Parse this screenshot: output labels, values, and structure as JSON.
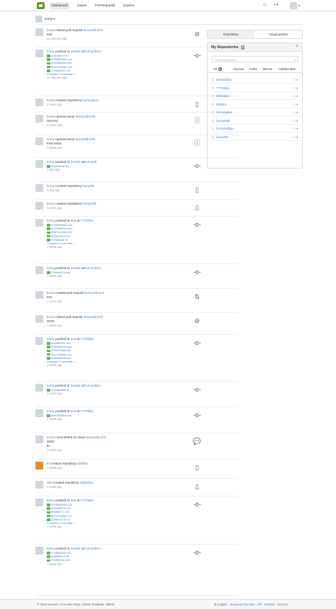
{
  "nav": {
    "dashboard": "Dashboard",
    "issues": "Issues",
    "pull_requests": "Pull Requests",
    "explore": "Explore"
  },
  "context_user": "lunny",
  "feed": [
    {
      "user": "lunny",
      "action": "closed pull request",
      "target": "lunny/ddoc#4",
      "text": "test",
      "time": "11 minutes ago",
      "icon": "pr-closed-icon",
      "glyph": "⊘"
    },
    {
      "user": "lunny",
      "action": "pushed to",
      "branch": "master",
      "at": "at",
      "target": "lunny/ddoc",
      "commits": [
        "c7609fe7f4 rrr",
        "879645ed43 ooo",
        "9c42de64bc eee",
        "8047bc2d6e 222",
        "1336e4624 111"
      ],
      "compare": "Compare 5 commits »",
      "time": "11 minutes ago",
      "icon": "commit-icon",
      "glyph": "-o-"
    },
    {
      "user": "lunny",
      "action": "created repository",
      "target": "lunny/gitea",
      "time": "2 hours ago",
      "icon": "repo-icon",
      "glyph": "▯"
    },
    {
      "user": "lunny",
      "action": "opened issue",
      "target": "lunny/ddoc#6",
      "text": "Second",
      "time": "2 hours ago",
      "icon": "issue-icon",
      "glyph": "ⓘ"
    },
    {
      "user": "lunny",
      "action": "opened issue",
      "target": "lunny/ddoc#5",
      "text": "First issue",
      "time": "2 hours ago",
      "icon": "issue-icon",
      "glyph": "ⓘ"
    },
    {
      "user": "lunny",
      "action": "pushed to",
      "branch": "master",
      "at": "at",
      "target": "lunny/ttt",
      "commits": [
        "2b8fb3ba6 sss"
      ],
      "time": "1 day ago",
      "icon": "commit-icon",
      "glyph": "-o-"
    },
    {
      "user": "lunny",
      "action": "created repository",
      "target": "lunny/ttt",
      "time": "1 day ago",
      "icon": "repo-icon",
      "glyph": "▯"
    },
    {
      "user": "lunny",
      "action": "created repository",
      "target": "lunny/sdk",
      "time": "1 week ago",
      "icon": "repo-icon",
      "glyph": "▯"
    },
    {
      "user": "lunny",
      "action": "pushed to",
      "branch": "test",
      "at": "at",
      "target": "777/ddoc",
      "commits": [
        "879645ed43 ooo",
        "9c42de64bc eee",
        "8047bc2d6e 222",
        "1336e4624 111",
        "179fa9d81 ttt"
      ],
      "compare": "Compare 5 commits »",
      "time": "1 week ago",
      "icon": "commit-icon",
      "glyph": "-o-"
    },
    {
      "user": "lunny",
      "action": "pushed to",
      "branch": "master",
      "at": "at",
      "target": "lunny/ddoc",
      "commits": [
        "1336e4624 sss"
      ],
      "time": "1 week ago",
      "icon": "commit-icon",
      "glyph": "-o-"
    },
    {
      "user": "lunny",
      "action": "created pull request",
      "target": "lunny/ddoc#4",
      "text": "test",
      "time": "1 week ago",
      "icon": "pr-icon",
      "glyph": "⇅"
    },
    {
      "user": "lunny",
      "action": "closed pull request",
      "target": "lunny/ddoc#3",
      "text": "3333",
      "time": "1 week ago",
      "icon": "pr-closed-icon",
      "glyph": "⊘"
    },
    {
      "user": "lunny",
      "action": "pushed to",
      "branch": "test",
      "at": "at",
      "target": "777/ddoc",
      "commits": [
        "3c8dff5788 ooo",
        "00dc953ee2 sss",
        "b791273a8 333",
        "74c77bb6bc 111",
        "3fdc8d4888 sss"
      ],
      "compare": "Compare 6 commits »",
      "time": "1 week ago",
      "icon": "commit-icon",
      "glyph": "-o-"
    },
    {
      "user": "lunny",
      "action": "pushed to",
      "branch": "master",
      "at": "at",
      "target": "lunny/ddoc",
      "commits": [
        "15dc8ed8fd ss"
      ],
      "time": "1 week ago",
      "icon": "commit-icon",
      "glyph": "-o-"
    },
    {
      "user": "lunny",
      "action": "pushed to",
      "branch": "test",
      "at": "at",
      "target": "777/ddoc",
      "commits": [
        "daf43b0f6c4 sss"
      ],
      "time": "1 week ago",
      "icon": "commit-icon",
      "glyph": "-o-"
    },
    {
      "user": "lunny",
      "action": "commented on issue",
      "target": "lunny/ddoc#3",
      "text": "3333",
      "text2": "ttt",
      "time": "1 week ago",
      "icon": "comment-icon",
      "glyph": "💬"
    },
    {
      "user": "ttt",
      "action": "created repository",
      "target": "ttt/ddoc",
      "time": "1 week ago",
      "icon": "repo-icon",
      "glyph": "▯",
      "orange": true
    },
    {
      "user": "ddd",
      "action": "created repository",
      "target": "ddd/ddoc",
      "time": "1 week ago",
      "icon": "repo-icon",
      "glyph": "▯"
    },
    {
      "user": "lunny",
      "action": "pushed to",
      "branch": "test",
      "at": "at",
      "target": "777/ddoc",
      "commits": [
        "4c28995906 222",
        "b3dc3b0f7a 111",
        "596d8f712 111",
        "8e7e933f6a 222",
        "1336e4378 111"
      ],
      "compare": "Compare 5 commits »",
      "time": "1 week ago",
      "icon": "commit-icon",
      "glyph": "-o-"
    },
    {
      "user": "lunny",
      "action": "pushed to",
      "branch": "master",
      "at": "at",
      "target": "lunny/ddoc",
      "commits": [
        "21c8bf41b3 111",
        "2b8f3d5ec5 fff",
        "9a1f6f0e6c sss"
      ],
      "time": "1 week ago",
      "icon": "commit-icon",
      "glyph": "-o-"
    }
  ],
  "sidebar": {
    "tab_repository": "Repository",
    "tab_organization": "Organization",
    "title": "My Repositories",
    "count": "8",
    "plus": "+",
    "find_placeholder": "Find a repository...",
    "filters": {
      "all": "All",
      "all_count": "8",
      "sources": "Sources",
      "forks": "Forks",
      "mirrors": "Mirrors",
      "collaborative": "Collaborative"
    },
    "repos": [
      {
        "name": "lunny/ddoc",
        "stars": "0 ★",
        "icon": "repo-icon"
      },
      {
        "name": "777/ddoc",
        "stars": "0 ★",
        "icon": "fork-icon"
      },
      {
        "name": "ddd/ddoc",
        "stars": "0 ★",
        "icon": "fork-icon"
      },
      {
        "name": "ttt/ddoc",
        "stars": "0 ★",
        "icon": "repo-icon"
      },
      {
        "name": "lunny/gitea",
        "stars": "0 ★",
        "icon": "repo-icon"
      },
      {
        "name": "lunny/sdk",
        "stars": "0 ★",
        "icon": "repo-icon"
      },
      {
        "name": "lunny/sdkgo",
        "stars": "0 ★",
        "icon": "repo-icon"
      },
      {
        "name": "lunny/ttt",
        "stars": "0 ★",
        "icon": "repo-icon"
      }
    ]
  },
  "footer": {
    "left": "© Gitea Version: 1.2.0+dev Page: 218ms Template: 195ms",
    "lang": "English",
    "licenses": "Javascript licenses",
    "api": "API",
    "website": "Website",
    "go": "Go1.8.2"
  }
}
